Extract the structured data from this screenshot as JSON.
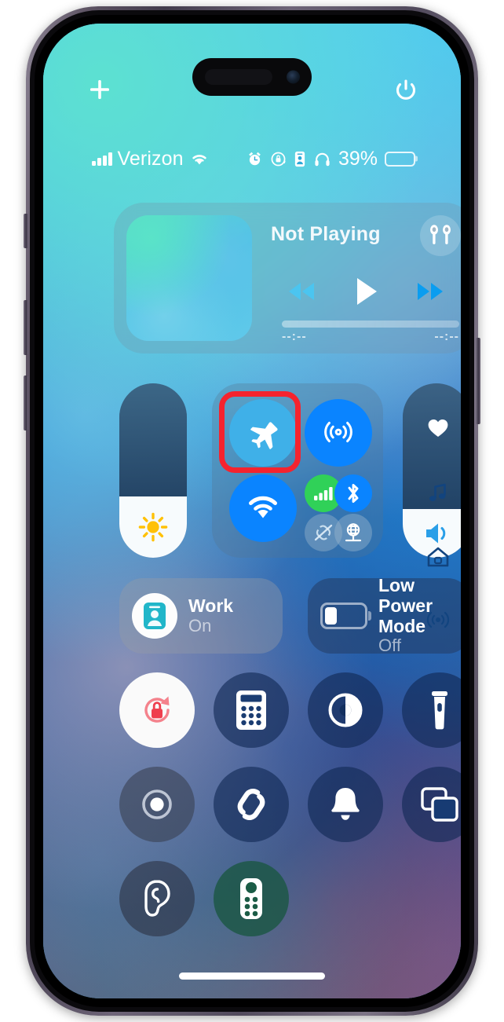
{
  "device": {
    "name": "iPhone",
    "frame_color": "#5d5363"
  },
  "status_bar": {
    "carrier": "Verizon",
    "battery_percent_label": "39%",
    "battery_level": 39,
    "icons": [
      "signal-bars-icon",
      "wifi-icon",
      "alarm-icon",
      "rotation-lock-icon",
      "screen-id-icon",
      "headphones-icon",
      "battery-icon"
    ]
  },
  "top_bar": {
    "add_control_label": "+",
    "add_control_name": "plus-icon",
    "power_name": "power-icon"
  },
  "media": {
    "title": "Not Playing",
    "airplay_device": "airpods-icon",
    "elapsed_time": "--:--",
    "remaining_time": "--:--",
    "progress_percent": 0,
    "controls": [
      "rewind-icon",
      "play-icon",
      "fast-forward-icon"
    ]
  },
  "connectivity": {
    "airplane_mode": {
      "label": "Airplane Mode",
      "state": "On",
      "color": "#3fb0e8",
      "highlighted": true
    },
    "airdrop": {
      "label": "AirDrop",
      "state": "On",
      "color": "#0a84ff"
    },
    "wifi": {
      "label": "Wi-Fi",
      "state": "On",
      "color": "#0a84ff"
    },
    "cellular_data": {
      "label": "Cellular Data",
      "state": "On",
      "color": "#30d158"
    },
    "bluetooth": {
      "label": "Bluetooth",
      "state": "On",
      "color": "#0a84ff"
    },
    "personal_hotspot": {
      "label": "Personal Hotspot",
      "state": "Off",
      "color": "#8fa7bd"
    },
    "vpn": {
      "label": "VPN",
      "state": "On",
      "color": "#96b4cd"
    }
  },
  "sliders": {
    "brightness": {
      "label": "Brightness",
      "value": 35,
      "icon": "sun-icon"
    },
    "volume": {
      "label": "Volume",
      "value": 28,
      "icon": "speaker-icon"
    }
  },
  "tiles": [
    {
      "name": "focus-tile",
      "title": "Work",
      "subtitle": "On",
      "icon": "id-badge-icon"
    },
    {
      "name": "low-power-mode-tile",
      "title": "Low Power Mode",
      "subtitle": "Off",
      "icon": "battery-low-icon"
    }
  ],
  "controls_grid": [
    {
      "name": "rotation-lock-button",
      "label": "Rotation Lock",
      "state": "On",
      "icon": "rotation-lock-icon"
    },
    {
      "name": "calculator-button",
      "label": "Calculator",
      "state": "Off",
      "icon": "calculator-icon"
    },
    {
      "name": "dark-mode-button",
      "label": "Dark Mode",
      "state": "Off",
      "icon": "contrast-circle-icon"
    },
    {
      "name": "flashlight-button",
      "label": "Flashlight",
      "state": "Off",
      "icon": "flashlight-icon"
    },
    {
      "name": "screen-recording-button",
      "label": "Screen Recording",
      "state": "Off",
      "icon": "record-icon"
    },
    {
      "name": "shazam-button",
      "label": "Music Recognition",
      "state": "Off",
      "icon": "shazam-icon"
    },
    {
      "name": "alarm-button",
      "label": "Alarm",
      "state": "Off",
      "icon": "bell-icon"
    },
    {
      "name": "screen-mirroring-button",
      "label": "Screen Mirroring",
      "state": "Off",
      "icon": "screen-mirroring-icon"
    },
    {
      "name": "hearing-button",
      "label": "Hearing",
      "state": "Off",
      "icon": "ear-icon"
    },
    {
      "name": "apple-tv-remote-button",
      "label": "Apple TV Remote",
      "state": "Off",
      "icon": "remote-icon"
    }
  ],
  "page_rail": [
    {
      "name": "rail-favorites",
      "icon": "heart-icon",
      "active": true
    },
    {
      "name": "rail-music",
      "icon": "music-note-icon",
      "active": false
    },
    {
      "name": "rail-home",
      "icon": "home-icon",
      "active": false
    },
    {
      "name": "rail-connectivity",
      "icon": "connectivity-icon",
      "active": false
    }
  ],
  "annotation": {
    "type": "highlight-box",
    "color": "#f5232e",
    "target": "airplane-mode-button"
  },
  "home_indicator": {
    "name": "home-indicator"
  }
}
